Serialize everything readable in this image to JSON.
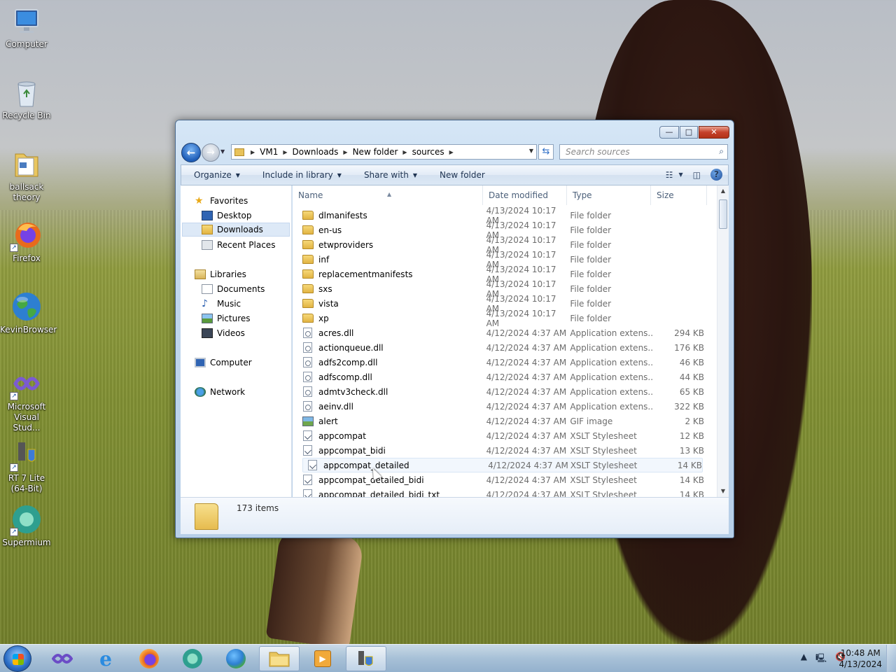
{
  "desktop": {
    "icons": [
      {
        "label": "Computer",
        "icon": "computer-icon"
      },
      {
        "label": "Recycle Bin",
        "icon": "recycle-bin-icon"
      },
      {
        "label": "ballsack theory",
        "icon": "folder-icon"
      },
      {
        "label": "Firefox",
        "icon": "firefox-icon"
      },
      {
        "label": "KevinBrowser",
        "icon": "globe-icon"
      },
      {
        "label": "Microsoft Visual Stud...",
        "icon": "visual-studio-icon"
      },
      {
        "label": "RT 7 Lite (64-Bit)",
        "icon": "rt7lite-icon"
      },
      {
        "label": "Supermium",
        "icon": "supermium-icon"
      }
    ]
  },
  "window": {
    "caption_buttons": {
      "minimize": "—",
      "maximize": "□",
      "close": "✕"
    },
    "address": {
      "crumbs": [
        "VM1",
        "Downloads",
        "New folder",
        "sources"
      ]
    },
    "search": {
      "placeholder": "Search sources"
    },
    "commands": [
      "Organize",
      "Include in library",
      "Share with",
      "New folder"
    ],
    "nav": {
      "favorites": {
        "label": "Favorites",
        "items": [
          "Desktop",
          "Downloads",
          "Recent Places"
        ],
        "selected": "Downloads"
      },
      "libraries": {
        "label": "Libraries",
        "items": [
          "Documents",
          "Music",
          "Pictures",
          "Videos"
        ]
      },
      "computer": "Computer",
      "network": "Network"
    },
    "columns": [
      "Name",
      "Date modified",
      "Type",
      "Size"
    ],
    "files": [
      {
        "name": "dlmanifests",
        "date": "4/13/2024 10:17 AM",
        "type": "File folder",
        "size": "",
        "kind": "folder"
      },
      {
        "name": "en-us",
        "date": "4/13/2024 10:17 AM",
        "type": "File folder",
        "size": "",
        "kind": "folder"
      },
      {
        "name": "etwproviders",
        "date": "4/13/2024 10:17 AM",
        "type": "File folder",
        "size": "",
        "kind": "folder"
      },
      {
        "name": "inf",
        "date": "4/13/2024 10:17 AM",
        "type": "File folder",
        "size": "",
        "kind": "folder"
      },
      {
        "name": "replacementmanifests",
        "date": "4/13/2024 10:17 AM",
        "type": "File folder",
        "size": "",
        "kind": "folder"
      },
      {
        "name": "sxs",
        "date": "4/13/2024 10:17 AM",
        "type": "File folder",
        "size": "",
        "kind": "folder"
      },
      {
        "name": "vista",
        "date": "4/13/2024 10:17 AM",
        "type": "File folder",
        "size": "",
        "kind": "folder"
      },
      {
        "name": "xp",
        "date": "4/13/2024 10:17 AM",
        "type": "File folder",
        "size": "",
        "kind": "folder"
      },
      {
        "name": "acres.dll",
        "date": "4/12/2024 4:37 AM",
        "type": "Application extens...",
        "size": "294 KB",
        "kind": "dll"
      },
      {
        "name": "actionqueue.dll",
        "date": "4/12/2024 4:37 AM",
        "type": "Application extens...",
        "size": "176 KB",
        "kind": "dll"
      },
      {
        "name": "adfs2comp.dll",
        "date": "4/12/2024 4:37 AM",
        "type": "Application extens...",
        "size": "46 KB",
        "kind": "dll"
      },
      {
        "name": "adfscomp.dll",
        "date": "4/12/2024 4:37 AM",
        "type": "Application extens...",
        "size": "44 KB",
        "kind": "dll"
      },
      {
        "name": "admtv3check.dll",
        "date": "4/12/2024 4:37 AM",
        "type": "Application extens...",
        "size": "65 KB",
        "kind": "dll"
      },
      {
        "name": "aeinv.dll",
        "date": "4/12/2024 4:37 AM",
        "type": "Application extens...",
        "size": "322 KB",
        "kind": "dll"
      },
      {
        "name": "alert",
        "date": "4/12/2024 4:37 AM",
        "type": "GIF image",
        "size": "2 KB",
        "kind": "gif"
      },
      {
        "name": "appcompat",
        "date": "4/12/2024 4:37 AM",
        "type": "XSLT Stylesheet",
        "size": "12 KB",
        "kind": "xsl"
      },
      {
        "name": "appcompat_bidi",
        "date": "4/12/2024 4:37 AM",
        "type": "XSLT Stylesheet",
        "size": "13 KB",
        "kind": "xsl"
      },
      {
        "name": "appcompat_detailed",
        "date": "4/12/2024 4:37 AM",
        "type": "XSLT Stylesheet",
        "size": "14 KB",
        "kind": "xsl"
      },
      {
        "name": "appcompat_detailed_bidi",
        "date": "4/12/2024 4:37 AM",
        "type": "XSLT Stylesheet",
        "size": "14 KB",
        "kind": "xsl"
      },
      {
        "name": "appcompat_detailed_bidi_txt",
        "date": "4/12/2024 4:37 AM",
        "type": "XSLT Stylesheet",
        "size": "14 KB",
        "kind": "xsl"
      }
    ],
    "hover_row": "appcompat_detailed",
    "details": {
      "count": "173 items"
    }
  },
  "taskbar": {
    "pinned": [
      "visual-studio-icon",
      "internet-explorer-icon",
      "firefox-icon",
      "supermium-icon",
      "globe-icon",
      "explorer-icon",
      "media-player-icon",
      "rt7lite-icon"
    ],
    "clock": {
      "time": "10:48 AM",
      "date": "4/13/2024"
    }
  }
}
